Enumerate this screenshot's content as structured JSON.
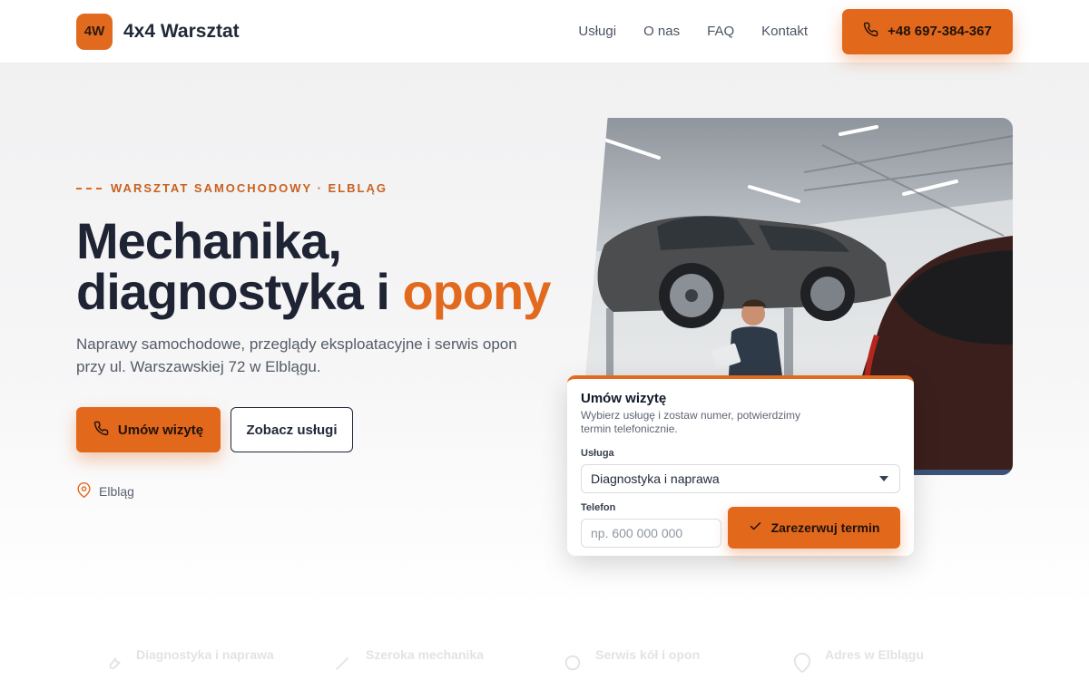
{
  "header": {
    "logo_text": "4W",
    "brand_name": "4x4 Warsztat",
    "nav": [
      "Usługi",
      "O nas",
      "FAQ",
      "Kontakt"
    ],
    "phone_label": "+48 697-384-367"
  },
  "hero": {
    "eyebrow": "WARSZTAT SAMOCHODOWY · ELBLĄG",
    "headline_line1": "Mechanika,",
    "headline_line2": "diagnostyka i ",
    "headline_accent": "opony",
    "subtext": "Naprawy samochodowe, przeglądy eksploatacyjne i serwis opon przy ul. Warszawskiej 72 w Elblągu.",
    "cta_primary": "Umów wizytę",
    "cta_secondary": "Zobacz usługi",
    "location": "Elbląg"
  },
  "booking": {
    "title": "Umów wizytę",
    "description": "Wybierz usługę i zostaw numer, potwierdzimy termin telefonicznie.",
    "service_label": "Usługa",
    "service_selected": "Diagnostyka i naprawa",
    "phone_label": "Telefon",
    "phone_placeholder": "np. 600 000 000",
    "submit_label": "Zarezerwuj termin"
  },
  "features": [
    {
      "title": "Diagnostyka i naprawa",
      "icon": "wrench-icon"
    },
    {
      "title": "Szeroka mechanika",
      "icon": "tool-icon"
    },
    {
      "title": "Serwis kół i opon",
      "icon": "tire-icon"
    },
    {
      "title": "Adres w Elblągu",
      "icon": "pin-icon"
    }
  ],
  "colors": {
    "accent": "#e26a1f",
    "text_dark": "#1e2433"
  }
}
